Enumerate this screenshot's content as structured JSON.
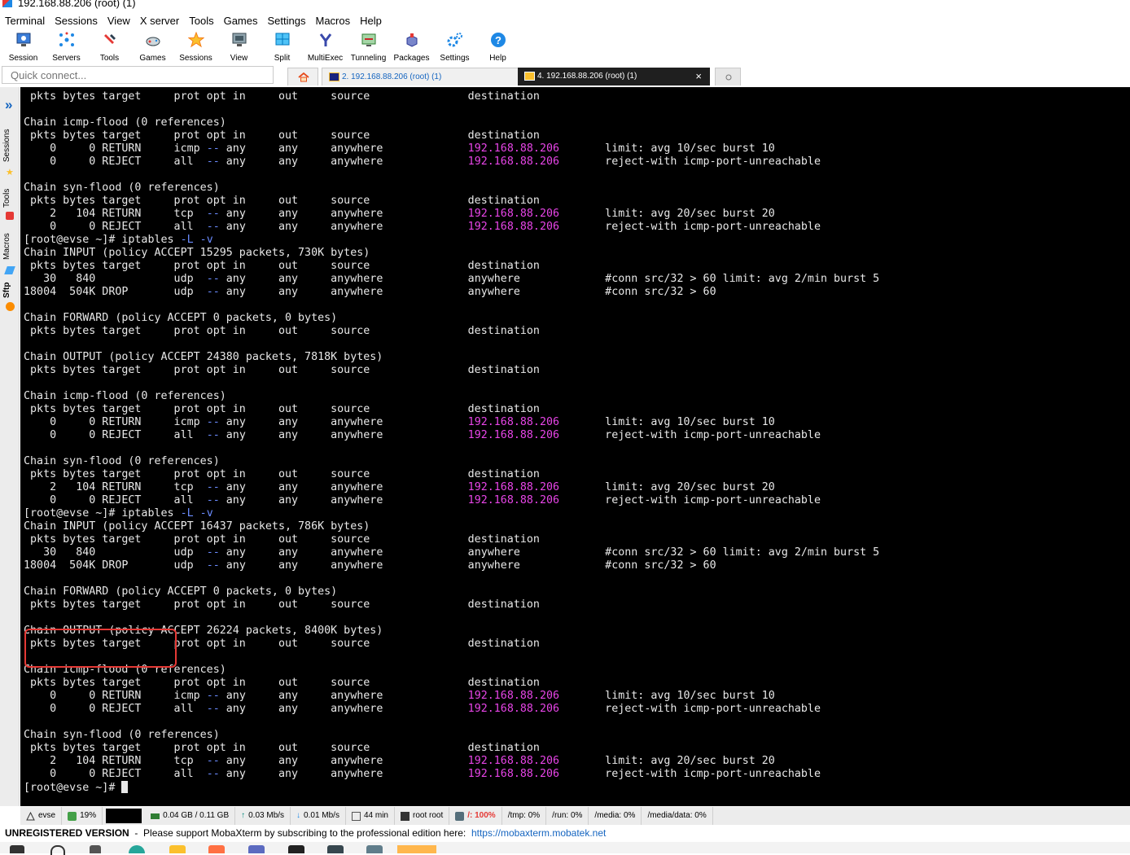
{
  "window": {
    "title": "192.168.88.206 (root) (1)"
  },
  "menu": [
    "Terminal",
    "Sessions",
    "View",
    "X server",
    "Tools",
    "Games",
    "Settings",
    "Macros",
    "Help"
  ],
  "toolbar": [
    {
      "label": "Session",
      "icon": "session-icon"
    },
    {
      "label": "Servers",
      "icon": "servers-icon"
    },
    {
      "label": "Tools",
      "icon": "tools-icon"
    },
    {
      "label": "Games",
      "icon": "games-icon"
    },
    {
      "label": "Sessions",
      "icon": "sessions-star-icon"
    },
    {
      "label": "View",
      "icon": "view-icon"
    },
    {
      "label": "Split",
      "icon": "split-icon"
    },
    {
      "label": "MultiExec",
      "icon": "multiexec-icon"
    },
    {
      "label": "Tunneling",
      "icon": "tunneling-icon"
    },
    {
      "label": "Packages",
      "icon": "packages-icon"
    },
    {
      "label": "Settings",
      "icon": "settings-gear-icon"
    },
    {
      "label": "Help",
      "icon": "help-icon"
    }
  ],
  "quick_connect": {
    "placeholder": "Quick connect..."
  },
  "tabs": [
    {
      "label": "2. 192.168.88.206 (root) (1)",
      "active": false
    },
    {
      "label": "4. 192.168.88.206 (root) (1)",
      "active": true,
      "close": "×"
    }
  ],
  "sidebar": {
    "collapse": "»",
    "items": [
      "Sessions",
      "Tools",
      "Macros",
      "Sftp"
    ]
  },
  "terminal": {
    "lines": [
      " pkts bytes target     prot opt in     out     source               destination",
      "",
      "Chain icmp-flood (0 references)",
      " pkts bytes target     prot opt in     out     source               destination",
      "    0     0 RETURN     icmp -- any     any     anywhere             192.168.88.206       limit: avg 10/sec burst 10",
      "    0     0 REJECT     all  -- any     any     anywhere             192.168.88.206       reject-with icmp-port-unreachable",
      "",
      "Chain syn-flood (0 references)",
      " pkts bytes target     prot opt in     out     source               destination",
      "    2   104 RETURN     tcp  -- any     any     anywhere             192.168.88.206       limit: avg 20/sec burst 20",
      "    0     0 REJECT     all  -- any     any     anywhere             192.168.88.206       reject-with icmp-port-unreachable",
      "[root@evse ~]# iptables -L -v",
      "Chain INPUT (policy ACCEPT 15295 packets, 730K bytes)",
      " pkts bytes target     prot opt in     out     source               destination",
      "   30   840            udp  -- any     any     anywhere             anywhere             #conn src/32 > 60 limit: avg 2/min burst 5",
      "18004  504K DROP       udp  -- any     any     anywhere             anywhere             #conn src/32 > 60",
      "",
      "Chain FORWARD (policy ACCEPT 0 packets, 0 bytes)",
      " pkts bytes target     prot opt in     out     source               destination",
      "",
      "Chain OUTPUT (policy ACCEPT 24380 packets, 7818K bytes)",
      " pkts bytes target     prot opt in     out     source               destination",
      "",
      "Chain icmp-flood (0 references)",
      " pkts bytes target     prot opt in     out     source               destination",
      "    0     0 RETURN     icmp -- any     any     anywhere             192.168.88.206       limit: avg 10/sec burst 10",
      "    0     0 REJECT     all  -- any     any     anywhere             192.168.88.206       reject-with icmp-port-unreachable",
      "",
      "Chain syn-flood (0 references)",
      " pkts bytes target     prot opt in     out     source               destination",
      "    2   104 RETURN     tcp  -- any     any     anywhere             192.168.88.206       limit: avg 20/sec burst 20",
      "    0     0 REJECT     all  -- any     any     anywhere             192.168.88.206       reject-with icmp-port-unreachable",
      "[root@evse ~]# iptables -L -v",
      "Chain INPUT (policy ACCEPT 16437 packets, 786K bytes)",
      " pkts bytes target     prot opt in     out     source               destination",
      "   30   840            udp  -- any     any     anywhere             anywhere             #conn src/32 > 60 limit: avg 2/min burst 5",
      "18004  504K DROP       udp  -- any     any     anywhere             anywhere             #conn src/32 > 60",
      "",
      "Chain FORWARD (policy ACCEPT 0 packets, 0 bytes)",
      " pkts bytes target     prot opt in     out     source               destination",
      "",
      "Chain OUTPUT (policy ACCEPT 26224 packets, 8400K bytes)",
      " pkts bytes target     prot opt in     out     source               destination",
      "",
      "Chain icmp-flood (0 references)",
      " pkts bytes target     prot opt in     out     source               destination",
      "    0     0 RETURN     icmp -- any     any     anywhere             192.168.88.206       limit: avg 10/sec burst 10",
      "    0     0 REJECT     all  -- any     any     anywhere             192.168.88.206       reject-with icmp-port-unreachable",
      "",
      "Chain syn-flood (0 references)",
      " pkts bytes target     prot opt in     out     source               destination",
      "    2   104 RETURN     tcp  -- any     any     anywhere             192.168.88.206       limit: avg 20/sec burst 20",
      "    0     0 REJECT     all  -- any     any     anywhere             192.168.88.206       reject-with icmp-port-unreachable",
      "[root@evse ~]# "
    ],
    "highlight_color": "#e53935"
  },
  "statusbar": [
    {
      "text": "evse",
      "icon": "server-icon"
    },
    {
      "text": "19%",
      "icon": "cpu-icon"
    },
    {
      "text": "0.04 GB / 0.11 GB",
      "icon": "memory-icon"
    },
    {
      "text": "0.03 Mb/s",
      "icon": "upload-arrow-icon"
    },
    {
      "text": "0.01 Mb/s",
      "icon": "download-arrow-icon"
    },
    {
      "text": "44 min",
      "icon": "uptime-monitor-icon"
    },
    {
      "text": "root  root",
      "icon": "user-icon"
    },
    {
      "text": "/: 100%",
      "icon": "disk-icon",
      "color": "#e53935"
    },
    {
      "text": "/tmp: 0%"
    },
    {
      "text": "/run: 0%"
    },
    {
      "text": "/media: 0%"
    },
    {
      "text": "/media/data: 0%"
    }
  ],
  "footer": {
    "version": "UNREGISTERED VERSION",
    "sep": "-",
    "message": "Please support MobaXterm by subscribing to the professional edition here:",
    "link": "https://mobaxterm.mobatek.net"
  },
  "colors": {
    "terminal_bg": "#000000",
    "ip_color": "#e845e8",
    "dashes_color": "#6b8cff",
    "accent_blue": "#1565c0"
  }
}
